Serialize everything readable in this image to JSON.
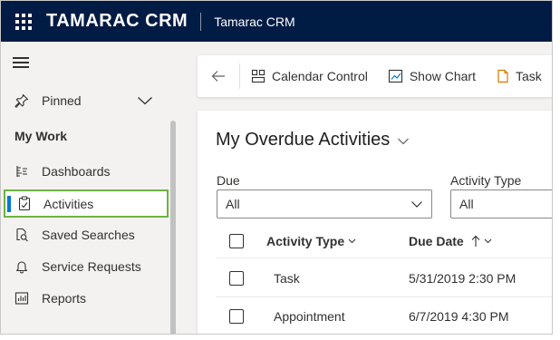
{
  "header": {
    "brand": "TAMARAC CRM",
    "app_title": "Tamarac CRM"
  },
  "sidebar": {
    "pinned_label": "Pinned",
    "section_title": "My Work",
    "items": [
      {
        "label": "Dashboards",
        "icon": "dashboard-icon"
      },
      {
        "label": "Activities",
        "icon": "activities-icon",
        "selected": true
      },
      {
        "label": "Saved Searches",
        "icon": "saved-search-icon"
      },
      {
        "label": "Service Requests",
        "icon": "bell-icon"
      },
      {
        "label": "Reports",
        "icon": "reports-icon"
      }
    ]
  },
  "commandbar": {
    "calendar_label": "Calendar Control",
    "chart_label": "Show Chart",
    "task_label": "Task"
  },
  "view": {
    "title": "My Overdue Activities",
    "filters": {
      "due_label": "Due",
      "due_value": "All",
      "type_label": "Activity Type",
      "type_value": "All"
    },
    "columns": {
      "activity_type": "Activity Type",
      "due_date": "Due Date"
    },
    "rows": [
      {
        "activity_type": "Task",
        "due_date": "5/31/2019 2:30 PM"
      },
      {
        "activity_type": "Appointment",
        "due_date": "6/7/2019 4:30 PM"
      }
    ]
  },
  "colors": {
    "topbar": "#001b44",
    "selected_outline": "#6db33f",
    "selected_bar": "#0078d4",
    "task_icon": "#d47800"
  }
}
